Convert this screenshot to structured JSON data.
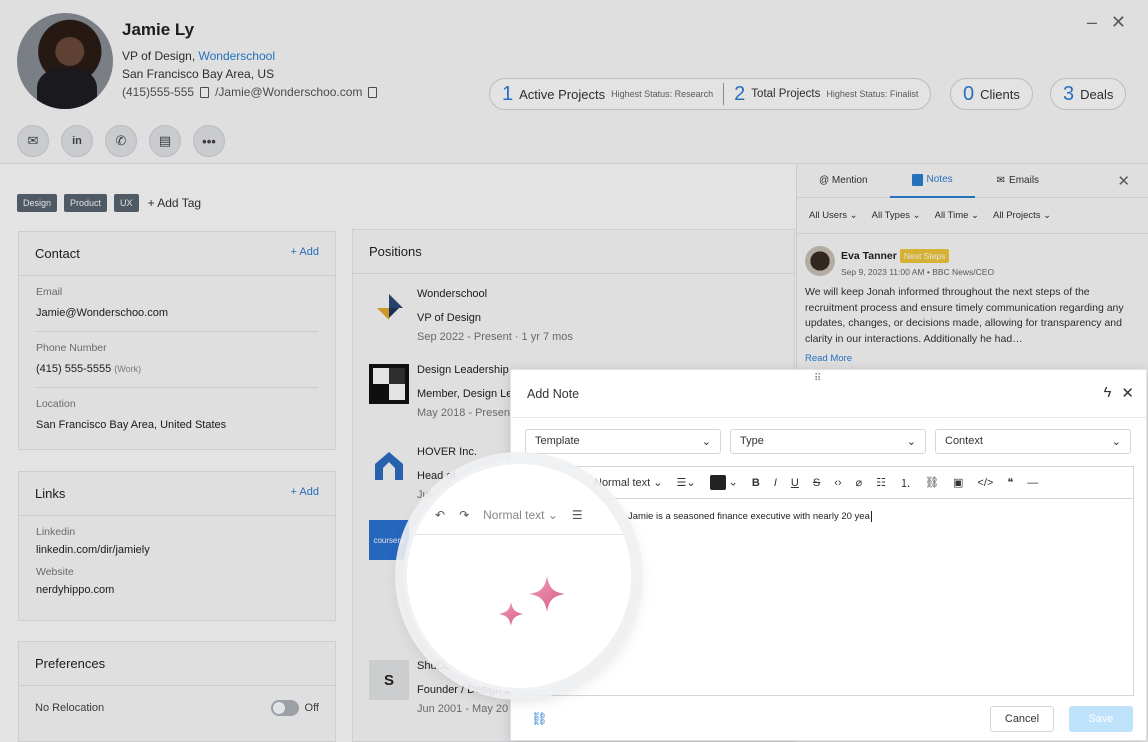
{
  "profile": {
    "name": "Jamie Ly",
    "role_prefix": "VP of Design, ",
    "company": "Wonderschool",
    "location": "San Francisco Bay Area, US",
    "phone": "(415)555-555",
    "email_short": "/Jamie@Wonderschoo.com"
  },
  "stats": {
    "active_num": "1",
    "active_label": "Active Projects",
    "active_status": "Highest Status: Research",
    "total_num": "2",
    "total_label": "Total Projects",
    "total_status": "Highest Status: Finalist",
    "clients_num": "0",
    "clients_label": "Clients",
    "deals_num": "3",
    "deals_label": "Deals"
  },
  "tags": [
    "Design",
    "Product",
    "UX"
  ],
  "add_tag": "Add Tag",
  "contact": {
    "title": "Contact",
    "add": "+ Add",
    "email_label": "Email",
    "email": "Jamie@Wonderschoo.com",
    "phone_label": "Phone Number",
    "phone": "(415) 555-5555",
    "phone_type": "(Work)",
    "location_label": "Location",
    "location": "San Francisco Bay Area, United States"
  },
  "links": {
    "title": "Links",
    "add": "+ Add",
    "linkedin_label": "Linkedin",
    "linkedin": "linkedin.com/dir/jamiely",
    "website_label": "Website",
    "website": "nerdyhippo.com"
  },
  "preferences": {
    "title": "Preferences",
    "relocation": "No Relocation",
    "relocation_state": "Off"
  },
  "positions": {
    "title": "Positions",
    "items": [
      {
        "company": "Wonderschool",
        "role": "VP of Design",
        "dates": "Sep 2022 - Present · 1 yr 7 mos"
      },
      {
        "company": "Design Leadership",
        "role": "Member, Design Le",
        "dates": "May 2018 - Present"
      },
      {
        "company": "HOVER Inc.",
        "role": "Head of",
        "dates": "Jul"
      },
      {
        "company": "ShuDes",
        "role": "Founder / Design L",
        "dates": "Jun 2001 - May 20"
      }
    ]
  },
  "notes_panel": {
    "tab_mention": "@ Mention",
    "tab_notes": "Notes",
    "tab_emails": "Emails",
    "filters": [
      "All Users",
      "All Types",
      "All Time",
      "All Projects"
    ],
    "author": "Eva Tanner",
    "badge": "Next Steps",
    "meta": "Sep 9, 2023 11:00 AM • BBC News/CEO",
    "body": "We will keep Jonah informed throughout the next steps of the recruitment process and ensure timely communication regarding any updates, changes, or decisions made, allowing for transparency and clarity in our interactions. Additionally he had…",
    "read_more": "Read More"
  },
  "modal": {
    "title": "Add Note",
    "template": "Template",
    "type": "Type",
    "context": "Context",
    "text_style": "Normal text",
    "content": "Jamie is a seasoned finance executive with nearly 20 yea",
    "cancel": "Cancel",
    "save": "Save"
  },
  "lens": {
    "text_style": "Normal text",
    "brand": "coursera"
  },
  "colors": {
    "accent": "#2a7fd4",
    "badge": "#f0c73b",
    "save_disabled": "#bfe2fb"
  }
}
